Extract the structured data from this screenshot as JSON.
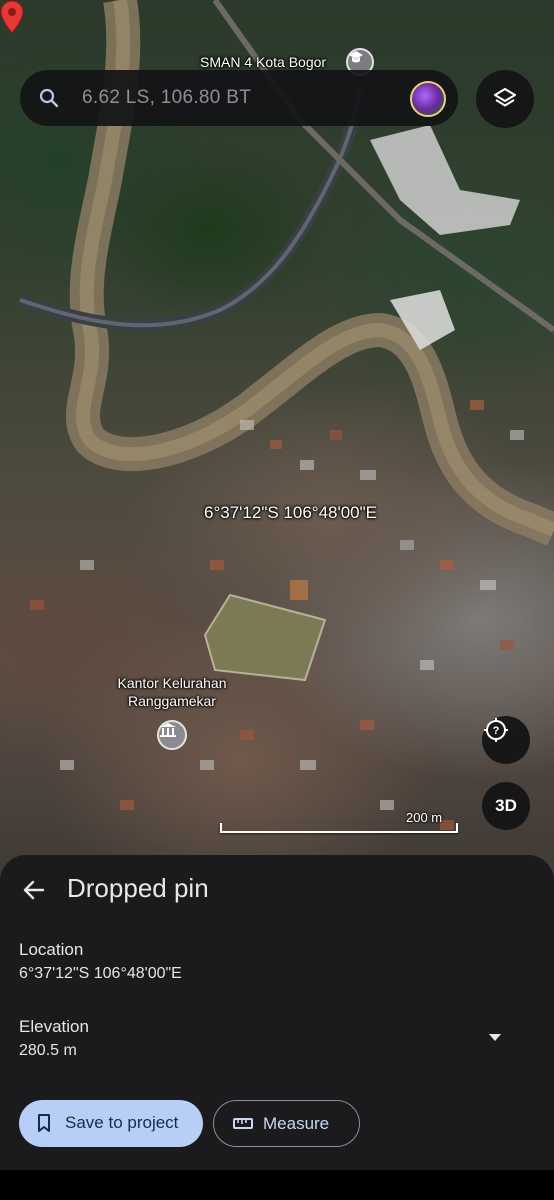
{
  "search": {
    "coords": "6.62 LS, 106.80 BT"
  },
  "map": {
    "poi_school": "SMAN 4 Kota Bogor",
    "pin_coords": "6°37'12\"S 106°48'00\"E",
    "poi_office": "Kantor Kelurahan Ranggamekar",
    "three_d_label": "3D",
    "scale_label": "200 m"
  },
  "sheet": {
    "title": "Dropped pin",
    "location_label": "Location",
    "location_value": "6°37'12\"S 106°48'00\"E",
    "elevation_label": "Elevation",
    "elevation_value": "280.5 m",
    "save_button": "Save to project",
    "measure_button": "Measure"
  },
  "icons": {
    "search": "search-icon",
    "layers": "layers-icon",
    "back": "arrow-back-icon",
    "bookmark": "bookmark-icon",
    "ruler": "ruler-icon",
    "locate": "locate-icon",
    "expand": "chevron-down-icon",
    "pin": "map-pin-icon"
  },
  "colors": {
    "pin": "#e53935",
    "save_button_bg": "#b7cff7",
    "sheet_bg": "#1b1b1d"
  }
}
